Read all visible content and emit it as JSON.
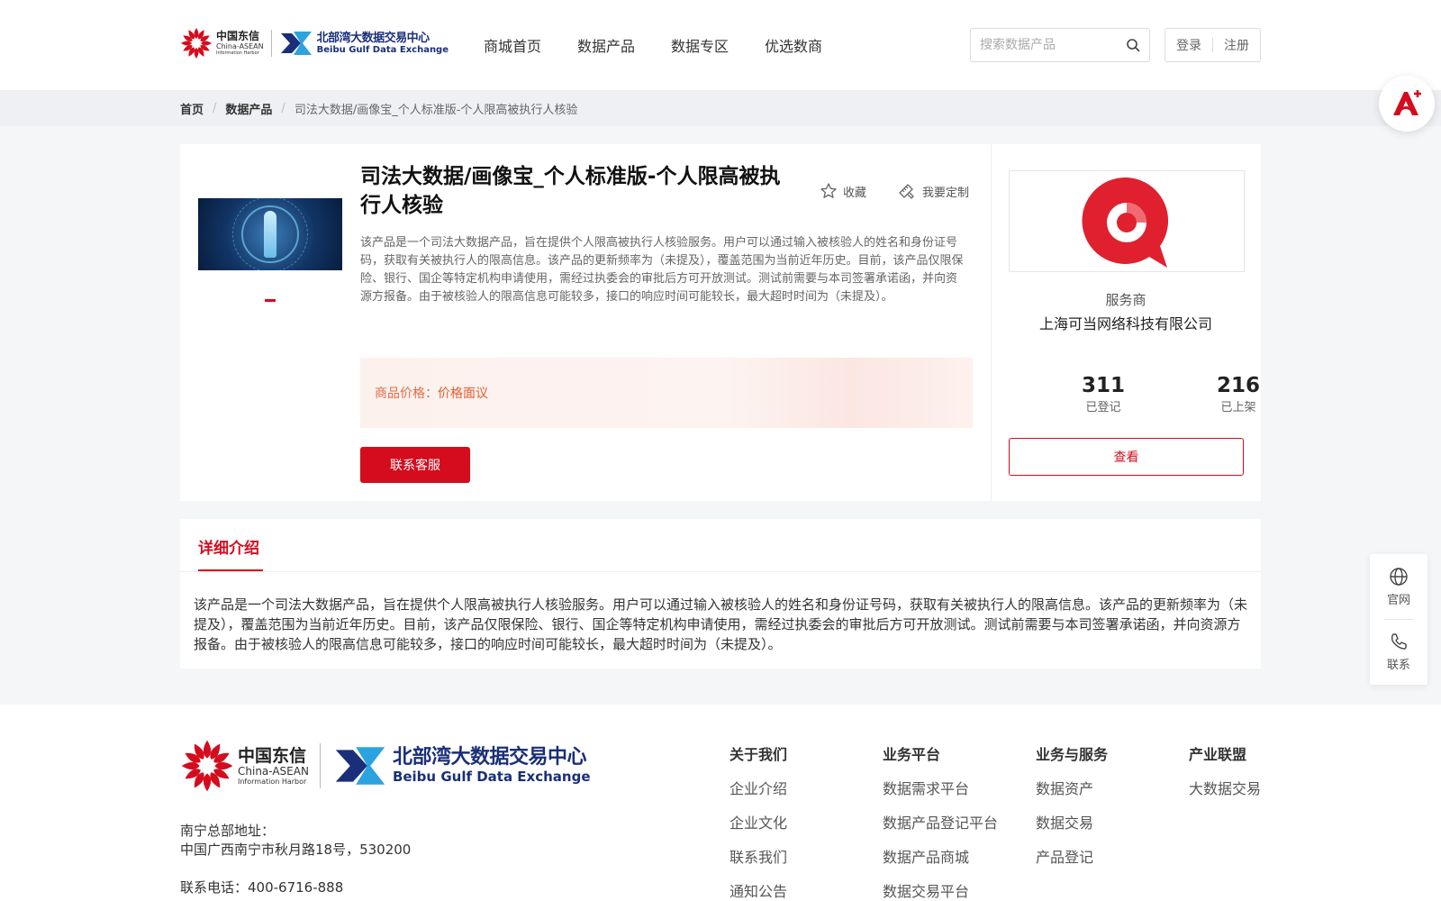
{
  "header": {
    "logo_cn": {
      "line1": "中国东信",
      "line2": "China-ASEAN",
      "line3": "Information Harbor"
    },
    "logo_bb": {
      "line1": "北部湾大数据交易中心",
      "line2": "Beibu Gulf Data Exchange"
    },
    "nav": [
      "商城首页",
      "数据产品",
      "数据专区",
      "优选数商"
    ],
    "search_placeholder": "搜索数据产品",
    "login": "登录",
    "register": "注册"
  },
  "breadcrumb": {
    "home": "首页",
    "section": "数据产品",
    "current": "司法大数据/画像宝_个人标准版-个人限高被执行人核验"
  },
  "product": {
    "title": "司法大数据/画像宝_个人标准版-个人限高被执行人核验",
    "favorite": "收藏",
    "customize": "我要定制",
    "description": "该产品是一个司法大数据产品，旨在提供个人限高被执行人核验服务。用户可以通过输入被核验人的姓名和身份证号码，获取有关被执行人的限高信息。该产品的更新频率为（未提及），覆盖范围为当前近年历史。目前，该产品仅限保险、银行、国企等特定机构申请使用，需经过执委会的审批后方可开放测试。测试前需要与本司签署承诺函，并向资源方报备。由于被核验人的限高信息可能较多，接口的响应时间可能较长，最大超时时间为（未提及）。",
    "price_label": "商品价格：",
    "price_value": "价格面议",
    "contact_button": "联系客服"
  },
  "vendor": {
    "label": "服务商",
    "name": "上海可当网络科技有限公司",
    "registered_count": "311",
    "registered_label": "已登记",
    "listed_count": "216",
    "listed_label": "已上架",
    "view_button": "查看"
  },
  "detail": {
    "tab": "详细介绍",
    "text": "该产品是一个司法大数据产品，旨在提供个人限高被执行人核验服务。用户可以通过输入被核验人的姓名和身份证号码，获取有关被执行人的限高信息。该产品的更新频率为（未提及），覆盖范围为当前近年历史。目前，该产品仅限保险、银行、国企等特定机构申请使用，需经过执委会的审批后方可开放测试。测试前需要与本司签署承诺函，并向资源方报备。由于被核验人的限高信息可能较多，接口的响应时间可能较长，最大超时时间为（未提及）。"
  },
  "side_tools": {
    "website": "官网",
    "contact": "联系"
  },
  "footer": {
    "address_label": "南宁总部地址：",
    "address": "中国广西南宁市秋月路18号，530200",
    "phone": "联系电话：400-6716-888",
    "columns": [
      {
        "heading": "关于我们",
        "items": [
          "企业介绍",
          "企业文化",
          "联系我们",
          "通知公告"
        ]
      },
      {
        "heading": "业务平台",
        "items": [
          "数据需求平台",
          "数据产品登记平台",
          "数据产品商城",
          "数据交易平台"
        ]
      },
      {
        "heading": "业务与服务",
        "items": [
          "数据资产",
          "数据交易",
          "产品登记"
        ]
      },
      {
        "heading": "产业联盟",
        "items": [
          "大数据交易"
        ]
      }
    ]
  },
  "colors": {
    "brand_red": "#d40c1d",
    "price_orange": "#e45d2e",
    "navy": "#1a2f7a",
    "sky": "#2aa3e0"
  }
}
